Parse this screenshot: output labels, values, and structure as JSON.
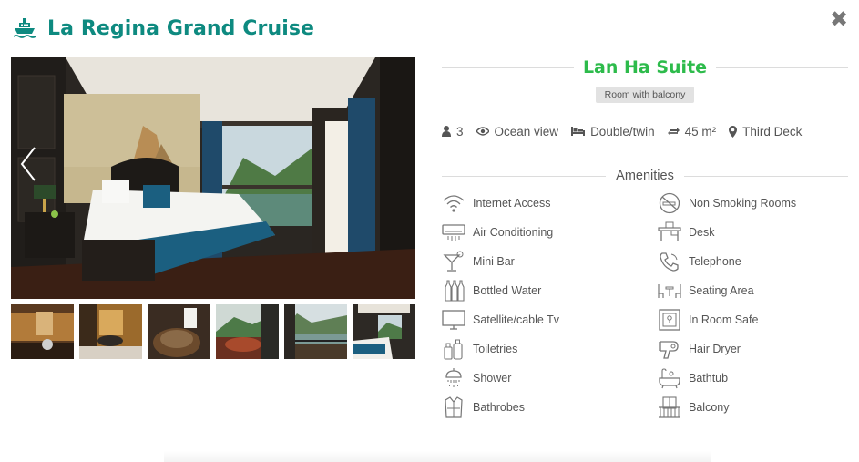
{
  "header": {
    "title": "La Regina Grand Cruise",
    "logo_icon": "cruise-ship-icon",
    "brand_color": "#0e8a80",
    "close_icon": "close-icon"
  },
  "gallery": {
    "main_image": "cabin-bedroom-photo",
    "prev_icon": "chevron-left-icon",
    "next_icon": "chevron-right-icon",
    "thumbnails": [
      "bathroom-vanity-photo",
      "bathroom-sink-photo",
      "wooden-basin-photo",
      "balcony-bathtub-photo",
      "balcony-view-photo",
      "bedroom-photo"
    ]
  },
  "room": {
    "name": "Lan Ha Suite",
    "name_color": "#2dbb4b",
    "badge": "Room with balcony",
    "specs": [
      {
        "icon": "user-icon",
        "text": "3"
      },
      {
        "icon": "eye-icon",
        "text": "Ocean view"
      },
      {
        "icon": "bed-icon",
        "text": "Double/twin"
      },
      {
        "icon": "resize-icon",
        "text": "45 m²"
      },
      {
        "icon": "map-marker-icon",
        "text": "Third Deck"
      }
    ]
  },
  "amenities": {
    "title": "Amenities",
    "items": [
      {
        "label": "Internet Access",
        "icon": "wifi-icon"
      },
      {
        "label": "Non Smoking Rooms",
        "icon": "no-smoking-icon"
      },
      {
        "label": "Air Conditioning",
        "icon": "air-conditioner-icon"
      },
      {
        "label": "Desk",
        "icon": "desk-icon"
      },
      {
        "label": "Mini Bar",
        "icon": "cocktail-icon"
      },
      {
        "label": "Telephone",
        "icon": "telephone-icon"
      },
      {
        "label": "Bottled Water",
        "icon": "bottles-icon"
      },
      {
        "label": "Seating Area",
        "icon": "seating-icon"
      },
      {
        "label": "Satellite/cable Tv",
        "icon": "tv-icon"
      },
      {
        "label": "In Room Safe",
        "icon": "safe-icon"
      },
      {
        "label": "Toiletries",
        "icon": "toiletries-icon"
      },
      {
        "label": "Hair Dryer",
        "icon": "hair-dryer-icon"
      },
      {
        "label": "Shower",
        "icon": "shower-icon"
      },
      {
        "label": "Bathtub",
        "icon": "bathtub-icon"
      },
      {
        "label": "Bathrobes",
        "icon": "bathrobe-icon"
      },
      {
        "label": "Balcony",
        "icon": "balcony-icon"
      }
    ]
  }
}
